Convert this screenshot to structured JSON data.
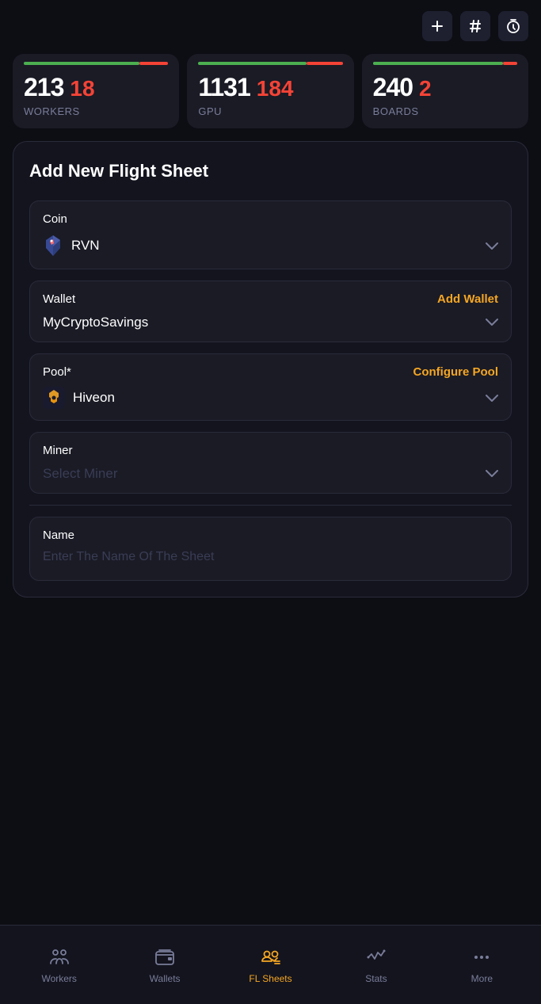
{
  "topbar": {
    "add_icon": "+",
    "hash_icon": "#",
    "timer_icon": "⏱"
  },
  "stats": [
    {
      "id": "workers",
      "main_value": "213",
      "alert_value": "18",
      "label": "WORKERS",
      "green_pct": 80,
      "red_pct": 20
    },
    {
      "id": "gpu",
      "main_value": "1131",
      "alert_value": "184",
      "label": "GPU",
      "green_pct": 75,
      "red_pct": 25
    },
    {
      "id": "boards",
      "main_value": "240",
      "alert_value": "2",
      "label": "BOARDS",
      "green_pct": 90,
      "red_pct": 10
    }
  ],
  "form": {
    "title": "Add New Flight Sheet",
    "coin_section": {
      "label": "Coin",
      "value": "RVN"
    },
    "wallet_section": {
      "label": "Wallet",
      "action": "Add Wallet",
      "value": "MyCryptoSavings"
    },
    "pool_section": {
      "label": "Pool*",
      "action": "Configure Pool",
      "value": "Hiveon"
    },
    "miner_section": {
      "label": "Miner",
      "placeholder": "Select Miner"
    },
    "name_section": {
      "label": "Name",
      "placeholder": "Enter The Name Of The Sheet"
    }
  },
  "bottom_nav": {
    "items": [
      {
        "id": "workers",
        "label": "Workers",
        "icon": "workers",
        "active": false
      },
      {
        "id": "wallets",
        "label": "Wallets",
        "icon": "wallets",
        "active": false
      },
      {
        "id": "fl-sheets",
        "label": "FL Sheets",
        "icon": "fl-sheets",
        "active": true
      },
      {
        "id": "stats",
        "label": "Stats",
        "icon": "stats",
        "active": false
      },
      {
        "id": "more",
        "label": "More",
        "icon": "more",
        "active": false
      }
    ]
  }
}
